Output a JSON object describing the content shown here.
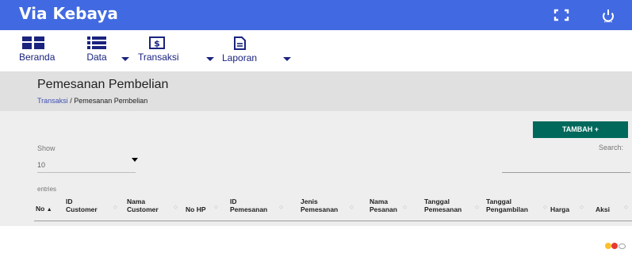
{
  "app": {
    "title": "Via Kebaya"
  },
  "topbar": {
    "icons": [
      "fullscreen-icon",
      "power-icon"
    ]
  },
  "menu": [
    {
      "label": "Beranda",
      "icon": "dashboard-icon",
      "has_dropdown": false
    },
    {
      "label": "Data",
      "icon": "list-icon",
      "has_dropdown": true
    },
    {
      "label": "Transaksi",
      "icon": "money-icon",
      "has_dropdown": true
    },
    {
      "label": "Laporan",
      "icon": "report-icon",
      "has_dropdown": true
    }
  ],
  "page": {
    "title": "Pemesanan Pembelian",
    "breadcrumb": {
      "link": "Transaksi",
      "separator": " / ",
      "current": "Pemesanan Pembelian"
    }
  },
  "toolbar": {
    "add_label": "TAMBAH +"
  },
  "table_controls": {
    "show_label": "Show",
    "page_size": "10",
    "entries_label": "entries",
    "search_label": "Search:"
  },
  "table": {
    "columns": [
      [
        "No"
      ],
      [
        "ID",
        "Customer"
      ],
      [
        "Nama",
        "Customer"
      ],
      [
        "No HP"
      ],
      [
        "ID",
        "Pemesanan"
      ],
      [
        "Jenis",
        "Pemesanan"
      ],
      [
        "Nama",
        "Pesanan"
      ],
      [
        "Tanggal",
        "Pemesanan"
      ],
      [
        "Tanggal",
        "Pengambilan"
      ],
      [
        "Harga"
      ],
      [
        "Aksi"
      ]
    ]
  },
  "colors": {
    "topbar": "#4169e1",
    "menu_text": "#1a237e",
    "add_button": "#00695c",
    "breadcrumb_link": "#3f51b5",
    "status_dots": [
      "#fbc02d",
      "#e53935",
      "#9e9e9e"
    ]
  }
}
